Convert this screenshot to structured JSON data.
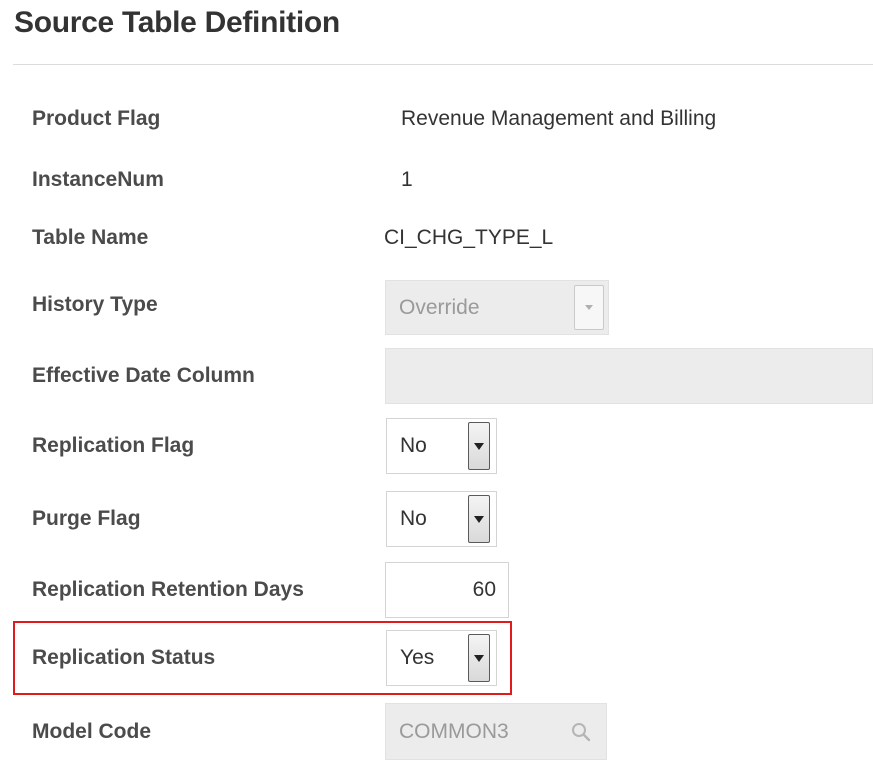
{
  "section": {
    "title": "Source Table Definition"
  },
  "fields": {
    "product_flag": {
      "label": "Product Flag",
      "value": "Revenue Management and Billing"
    },
    "instance_num": {
      "label": "InstanceNum",
      "value": "1"
    },
    "table_name": {
      "label": "Table Name",
      "value": "CI_CHG_TYPE_L"
    },
    "history_type": {
      "label": "History Type",
      "value": "Override",
      "disabled": true
    },
    "effective_date_column": {
      "label": "Effective Date Column",
      "value": "",
      "disabled": true
    },
    "replication_flag": {
      "label": "Replication Flag",
      "value": "No"
    },
    "purge_flag": {
      "label": "Purge Flag",
      "value": "No"
    },
    "replication_retention_days": {
      "label": "Replication Retention Days",
      "value": "60"
    },
    "replication_status": {
      "label": "Replication Status",
      "value": "Yes",
      "highlighted": true
    },
    "model_code": {
      "label": "Model Code",
      "value": "COMMON3",
      "disabled": true
    }
  },
  "colors": {
    "highlight_border": "#e01b1b",
    "label_text": "#4b4b4b",
    "disabled_bg": "#ececec"
  }
}
